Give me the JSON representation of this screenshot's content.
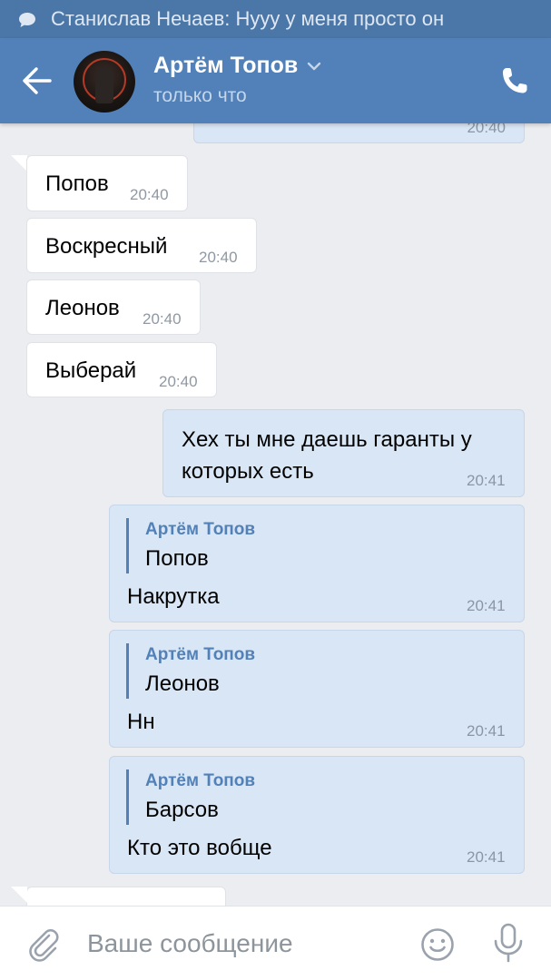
{
  "notification": {
    "text": "Станислав Нечаев: Нууу у меня просто он"
  },
  "header": {
    "title": "Артём Топов",
    "status": "только что"
  },
  "messages": {
    "top_partial_time": "20:40",
    "incoming": [
      {
        "text": "Попов",
        "time": "20:40"
      },
      {
        "text": "Воскресный",
        "time": "20:40"
      },
      {
        "text": "Леонов",
        "time": "20:40"
      },
      {
        "text": "Выберай",
        "time": "20:40"
      }
    ],
    "outgoing_plain": {
      "line1": "Хех ты мне даешь гаранты у",
      "line2": "которых есть",
      "time": "20:41"
    },
    "replies": [
      {
        "author": "Артём Топов",
        "quoted": "Попов",
        "text": "Накрутка",
        "time": "20:41"
      },
      {
        "author": "Артём Топов",
        "quoted": "Леонов",
        "text": "Нн",
        "time": "20:41"
      },
      {
        "author": "Артём Топов",
        "quoted": "Барсов",
        "text": "Кто это вобще",
        "time": "20:41"
      }
    ]
  },
  "composer": {
    "placeholder": "Ваше сообщение"
  },
  "colors": {
    "header_bg": "#5181b8",
    "status_bar_bg": "#4a76a8",
    "chat_bg": "#ebedf0",
    "outgoing_bubble": "#d9e6f5",
    "incoming_bubble": "#ffffff",
    "accent": "#5181b8"
  },
  "icons": [
    "chat-bubble-icon",
    "back-arrow-icon",
    "chevron-down-icon",
    "phone-icon",
    "paperclip-icon",
    "smile-icon",
    "microphone-icon"
  ]
}
